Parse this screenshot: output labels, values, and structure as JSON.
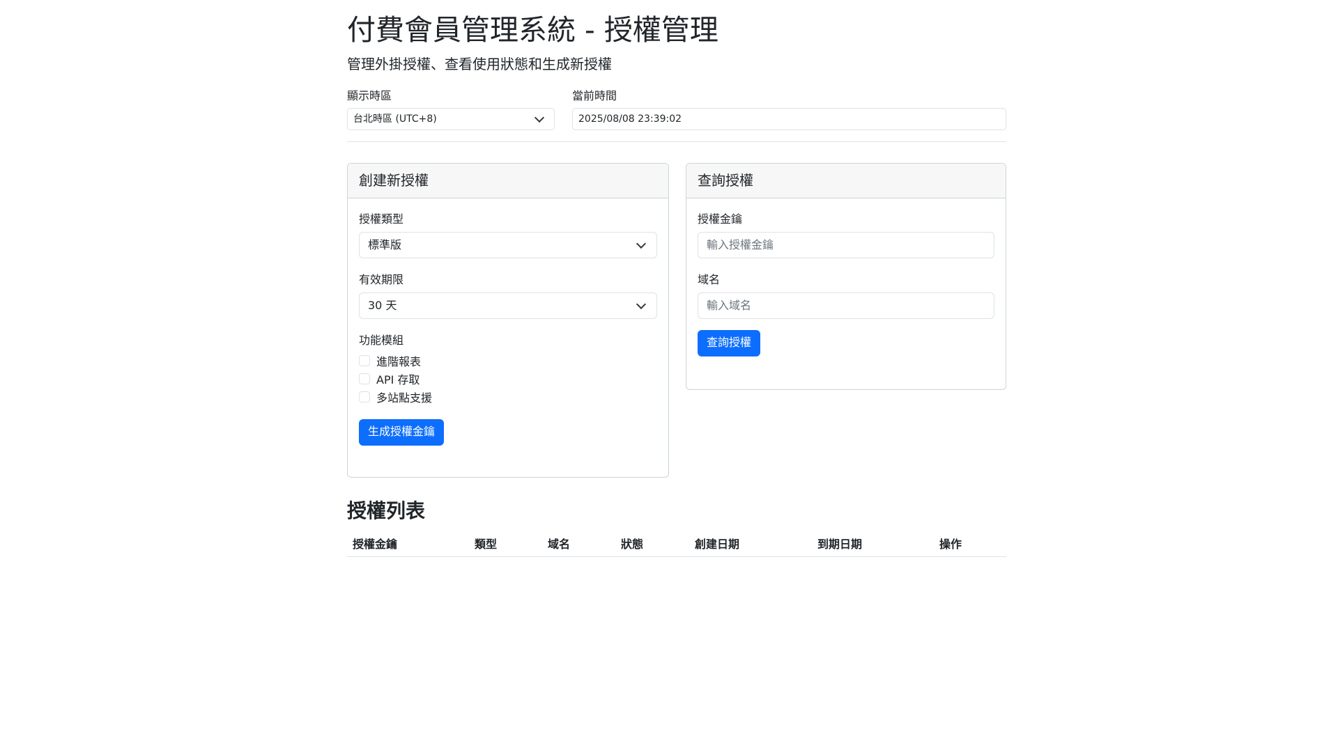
{
  "header": {
    "title": "付費會員管理系統 - 授權管理",
    "subtitle": "管理外掛授權、查看使用狀態和生成新授權"
  },
  "settings": {
    "timezone_label": "顯示時區",
    "timezone_value": "台北時區 (UTC+8)",
    "current_time_label": "當前時間",
    "current_time_value": "2025/08/08 23:39:02"
  },
  "create_card": {
    "title": "創建新授權",
    "type_label": "授權類型",
    "type_value": "標準版",
    "period_label": "有效期限",
    "period_value": "30 天",
    "modules_label": "功能模組",
    "modules": [
      {
        "label": "進階報表",
        "checked": false
      },
      {
        "label": "API 存取",
        "checked": false
      },
      {
        "label": "多站點支援",
        "checked": false
      }
    ],
    "submit_label": "生成授權金鑰"
  },
  "query_card": {
    "title": "查詢授權",
    "key_label": "授權金鑰",
    "key_placeholder": "輸入授權金鑰",
    "domain_label": "域名",
    "domain_placeholder": "輸入域名",
    "submit_label": "查詢授權"
  },
  "license_list": {
    "title": "授權列表",
    "columns": [
      "授權金鑰",
      "類型",
      "域名",
      "狀態",
      "創建日期",
      "到期日期",
      "操作"
    ]
  },
  "colors": {
    "primary": "#0d6efd",
    "border": "#dee2e6",
    "card_header_bg": "#f7f7f7"
  }
}
